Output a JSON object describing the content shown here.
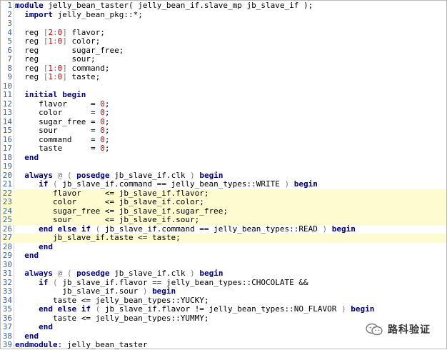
{
  "highlighted_lines": [
    22,
    23,
    24,
    25,
    27
  ],
  "lines": [
    [
      {
        "t": "module",
        "c": "kw"
      },
      {
        "t": " jelly_bean_taster( jelly_bean_if.slave_mp jb_slave_if );"
      }
    ],
    [
      {
        "t": "  "
      },
      {
        "t": "import",
        "c": "kw"
      },
      {
        "t": " jelly_bean_pkg::*;"
      }
    ],
    [],
    [
      {
        "t": "  reg "
      },
      {
        "t": "[",
        "c": "br"
      },
      {
        "t": "2",
        "c": "num"
      },
      {
        "t": ":",
        "c": "br"
      },
      {
        "t": "0",
        "c": "num"
      },
      {
        "t": "]",
        "c": "br"
      },
      {
        "t": " flavor;"
      }
    ],
    [
      {
        "t": "  reg "
      },
      {
        "t": "[",
        "c": "br"
      },
      {
        "t": "1",
        "c": "num"
      },
      {
        "t": ":",
        "c": "br"
      },
      {
        "t": "0",
        "c": "num"
      },
      {
        "t": "]",
        "c": "br"
      },
      {
        "t": " color;"
      }
    ],
    [
      {
        "t": "  reg       sugar_free;"
      }
    ],
    [
      {
        "t": "  reg       sour;"
      }
    ],
    [
      {
        "t": "  reg "
      },
      {
        "t": "[",
        "c": "br"
      },
      {
        "t": "1",
        "c": "num"
      },
      {
        "t": ":",
        "c": "br"
      },
      {
        "t": "0",
        "c": "num"
      },
      {
        "t": "]",
        "c": "br"
      },
      {
        "t": " command;"
      }
    ],
    [
      {
        "t": "  reg "
      },
      {
        "t": "[",
        "c": "br"
      },
      {
        "t": "1",
        "c": "num"
      },
      {
        "t": ":",
        "c": "br"
      },
      {
        "t": "0",
        "c": "num"
      },
      {
        "t": "]",
        "c": "br"
      },
      {
        "t": " taste;"
      }
    ],
    [],
    [
      {
        "t": "  "
      },
      {
        "t": "initial begin",
        "c": "kw"
      }
    ],
    [
      {
        "t": "     flavor     = "
      },
      {
        "t": "0",
        "c": "num"
      },
      {
        "t": ";"
      }
    ],
    [
      {
        "t": "     color      = "
      },
      {
        "t": "0",
        "c": "num"
      },
      {
        "t": ";"
      }
    ],
    [
      {
        "t": "     sugar_free = "
      },
      {
        "t": "0",
        "c": "num"
      },
      {
        "t": ";"
      }
    ],
    [
      {
        "t": "     sour       = "
      },
      {
        "t": "0",
        "c": "num"
      },
      {
        "t": ";"
      }
    ],
    [
      {
        "t": "     command    = "
      },
      {
        "t": "0",
        "c": "num"
      },
      {
        "t": ";"
      }
    ],
    [
      {
        "t": "     taste      = "
      },
      {
        "t": "0",
        "c": "num"
      },
      {
        "t": ";"
      }
    ],
    [
      {
        "t": "  "
      },
      {
        "t": "end",
        "c": "kw"
      }
    ],
    [],
    [
      {
        "t": "  "
      },
      {
        "t": "always",
        "c": "kw"
      },
      {
        "t": " @ ( ",
        "c": "br"
      },
      {
        "t": "posedge",
        "c": "kw"
      },
      {
        "t": " jb_slave_if.clk "
      },
      {
        "t": ")",
        "c": "br"
      },
      {
        "t": " "
      },
      {
        "t": "begin",
        "c": "kw"
      }
    ],
    [
      {
        "t": "     "
      },
      {
        "t": "if",
        "c": "kw"
      },
      {
        "t": " ( ",
        "c": "br"
      },
      {
        "t": "jb_slave_if.command == jelly_bean_types::WRITE "
      },
      {
        "t": ")",
        "c": "br"
      },
      {
        "t": " "
      },
      {
        "t": "begin",
        "c": "kw"
      }
    ],
    [
      {
        "t": "        flavor     <= jb_slave_if.flavor;"
      }
    ],
    [
      {
        "t": "        color      <= jb_slave_if.color;"
      }
    ],
    [
      {
        "t": "        sugar_free <= jb_slave_if.sugar_free;"
      }
    ],
    [
      {
        "t": "        sour       <= jb_slave_if.sour;"
      }
    ],
    [
      {
        "t": "     "
      },
      {
        "t": "end else if",
        "c": "kw"
      },
      {
        "t": " ( ",
        "c": "br"
      },
      {
        "t": "jb_slave_if.command == jelly_bean_types::READ "
      },
      {
        "t": ")",
        "c": "br"
      },
      {
        "t": " "
      },
      {
        "t": "begin",
        "c": "kw"
      }
    ],
    [
      {
        "t": "        jb_slave_if.taste <= taste;"
      }
    ],
    [
      {
        "t": "     "
      },
      {
        "t": "end",
        "c": "kw"
      }
    ],
    [
      {
        "t": "  "
      },
      {
        "t": "end",
        "c": "kw"
      }
    ],
    [],
    [
      {
        "t": "  "
      },
      {
        "t": "always",
        "c": "kw"
      },
      {
        "t": " @ ( ",
        "c": "br"
      },
      {
        "t": "posedge",
        "c": "kw"
      },
      {
        "t": " jb_slave_if.clk "
      },
      {
        "t": ")",
        "c": "br"
      },
      {
        "t": " "
      },
      {
        "t": "begin",
        "c": "kw"
      }
    ],
    [
      {
        "t": "     "
      },
      {
        "t": "if",
        "c": "kw"
      },
      {
        "t": " ( ",
        "c": "br"
      },
      {
        "t": "jb_slave_if.flavor == jelly_bean_types::CHOCOLATE &&"
      }
    ],
    [
      {
        "t": "          jb_slave_if.sour "
      },
      {
        "t": ")",
        "c": "br"
      },
      {
        "t": " "
      },
      {
        "t": "begin",
        "c": "kw"
      }
    ],
    [
      {
        "t": "        taste <= jelly_bean_types::YUCKY;"
      }
    ],
    [
      {
        "t": "     "
      },
      {
        "t": "end else if",
        "c": "kw"
      },
      {
        "t": " ( ",
        "c": "br"
      },
      {
        "t": "jb_slave_if.flavor != jelly_bean_types::NO_FLAVOR "
      },
      {
        "t": ")",
        "c": "br"
      },
      {
        "t": " "
      },
      {
        "t": "begin",
        "c": "kw"
      }
    ],
    [
      {
        "t": "        taste <= jelly_bean_types::YUMMY;"
      }
    ],
    [
      {
        "t": "     "
      },
      {
        "t": "end",
        "c": "kw"
      }
    ],
    [
      {
        "t": "  "
      },
      {
        "t": "end",
        "c": "kw"
      }
    ],
    [
      {
        "t": "endmodule",
        "c": "kw"
      },
      {
        "t": ": jelly_bean_taster"
      }
    ]
  ],
  "watermark": {
    "icon": "wechat-icon",
    "text": "路科验证"
  }
}
